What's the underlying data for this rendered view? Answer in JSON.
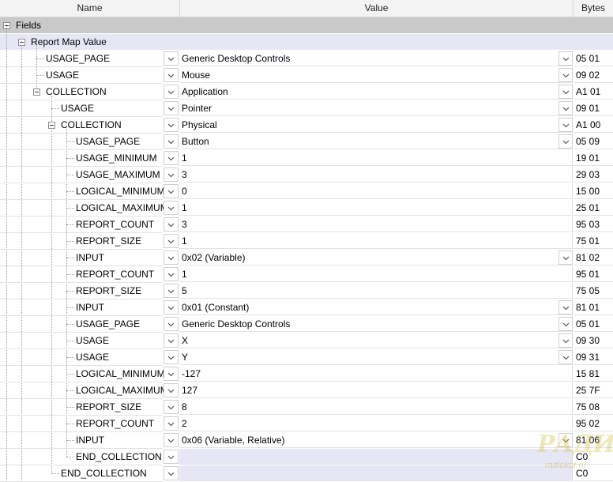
{
  "columns": {
    "name": "Name",
    "value": "Value",
    "bytes": "Bytes"
  },
  "root_label": "Fields",
  "group_label": "Report Map Value",
  "rows": [
    {
      "name": "USAGE_PAGE",
      "depth": 0,
      "value": "Generic Desktop Controls",
      "bytes": "05 01",
      "list": true,
      "toggle": false
    },
    {
      "name": "USAGE",
      "depth": 0,
      "value": "Mouse",
      "bytes": "09 02",
      "list": true,
      "toggle": false
    },
    {
      "name": "COLLECTION",
      "depth": 0,
      "value": "Application",
      "bytes": "A1 01",
      "list": true,
      "toggle": true
    },
    {
      "name": "USAGE",
      "depth": 1,
      "value": "Pointer",
      "bytes": "09 01",
      "list": true,
      "toggle": false
    },
    {
      "name": "COLLECTION",
      "depth": 1,
      "value": "Physical",
      "bytes": "A1 00",
      "list": true,
      "toggle": true
    },
    {
      "name": "USAGE_PAGE",
      "depth": 2,
      "value": "Button",
      "bytes": "05 09",
      "list": true,
      "toggle": false
    },
    {
      "name": "USAGE_MINIMUM",
      "depth": 2,
      "value": "1",
      "bytes": "19 01",
      "list": false,
      "toggle": false
    },
    {
      "name": "USAGE_MAXIMUM",
      "depth": 2,
      "value": "3",
      "bytes": "29 03",
      "list": false,
      "toggle": false
    },
    {
      "name": "LOGICAL_MINIMUM",
      "depth": 2,
      "value": "0",
      "bytes": "15 00",
      "list": false,
      "toggle": false
    },
    {
      "name": "LOGICAL_MAXIMUM",
      "depth": 2,
      "value": "1",
      "bytes": "25 01",
      "list": false,
      "toggle": false
    },
    {
      "name": "REPORT_COUNT",
      "depth": 2,
      "value": "3",
      "bytes": "95 03",
      "list": false,
      "toggle": false
    },
    {
      "name": "REPORT_SIZE",
      "depth": 2,
      "value": "1",
      "bytes": "75 01",
      "list": false,
      "toggle": false
    },
    {
      "name": "INPUT",
      "depth": 2,
      "value": "0x02 (Variable)",
      "bytes": "81 02",
      "list": true,
      "toggle": false
    },
    {
      "name": "REPORT_COUNT",
      "depth": 2,
      "value": "1",
      "bytes": "95 01",
      "list": false,
      "toggle": false
    },
    {
      "name": "REPORT_SIZE",
      "depth": 2,
      "value": "5",
      "bytes": "75 05",
      "list": false,
      "toggle": false
    },
    {
      "name": "INPUT",
      "depth": 2,
      "value": "0x01 (Constant)",
      "bytes": "81 01",
      "list": true,
      "toggle": false
    },
    {
      "name": "USAGE_PAGE",
      "depth": 2,
      "value": "Generic Desktop Controls",
      "bytes": "05 01",
      "list": true,
      "toggle": false
    },
    {
      "name": "USAGE",
      "depth": 2,
      "value": "X",
      "bytes": "09 30",
      "list": true,
      "toggle": false
    },
    {
      "name": "USAGE",
      "depth": 2,
      "value": "Y",
      "bytes": "09 31",
      "list": true,
      "toggle": false
    },
    {
      "name": "LOGICAL_MINIMUM",
      "depth": 2,
      "value": "-127",
      "bytes": "15 81",
      "list": false,
      "toggle": false
    },
    {
      "name": "LOGICAL_MAXIMUM",
      "depth": 2,
      "value": "127",
      "bytes": "25 7F",
      "list": false,
      "toggle": false
    },
    {
      "name": "REPORT_SIZE",
      "depth": 2,
      "value": "8",
      "bytes": "75 08",
      "list": false,
      "toggle": false
    },
    {
      "name": "REPORT_COUNT",
      "depth": 2,
      "value": "2",
      "bytes": "95 02",
      "list": false,
      "toggle": false
    },
    {
      "name": "INPUT",
      "depth": 2,
      "value": "0x06 (Variable, Relative)",
      "bytes": "81 06",
      "list": true,
      "toggle": false
    },
    {
      "name": "END_COLLECTION",
      "depth": 2,
      "value": "",
      "bytes": "C0",
      "list": false,
      "toggle": false
    },
    {
      "name": "END_COLLECTION",
      "depth": 1,
      "value": "",
      "bytes": "C0",
      "list": false,
      "toggle": false
    }
  ],
  "watermark": {
    "logo_text": "РАДИОКОТ",
    "url": "radiokot.ru"
  },
  "colors": {
    "header_bg": "#f3f3f3",
    "root_bg": "#c9c9c9",
    "group_bg": "#e6e6f5",
    "empty_value_bg": "#e6e6f5",
    "grid_line": "#e2e2e2"
  }
}
